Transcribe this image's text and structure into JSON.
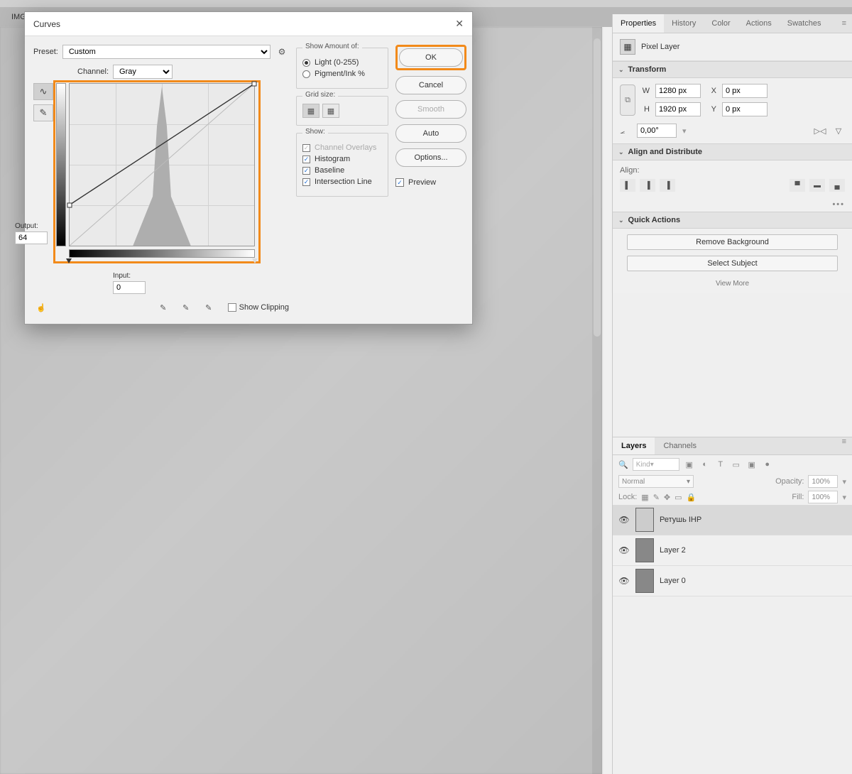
{
  "tabbar": {
    "doc": "IMG"
  },
  "right_panel": {
    "tabs": [
      "Properties",
      "History",
      "Color",
      "Actions",
      "Swatches"
    ],
    "active_tab": 0,
    "pixel_layer_label": "Pixel Layer",
    "transform": {
      "title": "Transform",
      "W_label": "W",
      "W": "1280 px",
      "H_label": "H",
      "H": "1920 px",
      "X_label": "X",
      "X": "0 px",
      "Y_label": "Y",
      "Y": "0 px",
      "angle": "0,00°"
    },
    "align": {
      "title": "Align and Distribute",
      "label": "Align:"
    },
    "quick_actions": {
      "title": "Quick Actions",
      "remove_bg": "Remove Background",
      "select_subject": "Select Subject",
      "view_more": "View More"
    }
  },
  "layers_panel": {
    "tabs": [
      "Layers",
      "Channels"
    ],
    "active_tab": 0,
    "kind_placeholder": "Kind",
    "blend_mode": "Normal",
    "opacity_label": "Opacity:",
    "opacity": "100%",
    "lock_label": "Lock:",
    "fill_label": "Fill:",
    "fill": "100%",
    "layers": [
      {
        "name": "Ретушь IHP",
        "active": true,
        "light": true
      },
      {
        "name": "Layer 2",
        "active": false,
        "light": false
      },
      {
        "name": "Layer 0",
        "active": false,
        "light": false
      }
    ]
  },
  "dialog": {
    "title": "Curves",
    "preset_label": "Preset:",
    "preset": "Custom",
    "channel_label": "Channel:",
    "channel": "Gray",
    "output_label": "Output:",
    "output": "64",
    "input_label": "Input:",
    "input": "0",
    "show_clipping": "Show Clipping",
    "show_amount": {
      "legend": "Show Amount of:",
      "light": "Light  (0-255)",
      "pigment": "Pigment/Ink %"
    },
    "grid_size": {
      "legend": "Grid size:"
    },
    "show": {
      "legend": "Show:",
      "channel_overlays": "Channel Overlays",
      "histogram": "Histogram",
      "baseline": "Baseline",
      "intersection": "Intersection Line"
    },
    "buttons": {
      "ok": "OK",
      "cancel": "Cancel",
      "smooth": "Smooth",
      "auto": "Auto",
      "options": "Options..."
    },
    "preview": "Preview"
  },
  "chart_data": {
    "type": "line",
    "title": "Curves adjustment (Gray channel) with histogram",
    "xlabel": "Input",
    "ylabel": "Output",
    "xlim": [
      0,
      255
    ],
    "ylim": [
      0,
      255
    ],
    "series": [
      {
        "name": "curve",
        "points": [
          {
            "x": 0,
            "y": 64
          },
          {
            "x": 255,
            "y": 255
          }
        ]
      },
      {
        "name": "baseline",
        "points": [
          {
            "x": 0,
            "y": 0
          },
          {
            "x": 255,
            "y": 255
          }
        ]
      }
    ],
    "histogram": {
      "peak_input": 128,
      "peak_height_pct": 98,
      "range_with_mass": [
        70,
        185
      ],
      "shape": "single narrow peak centred near mid-grays"
    },
    "control_points": [
      {
        "in": 0,
        "out": 64
      },
      {
        "in": 255,
        "out": 255
      }
    ]
  }
}
